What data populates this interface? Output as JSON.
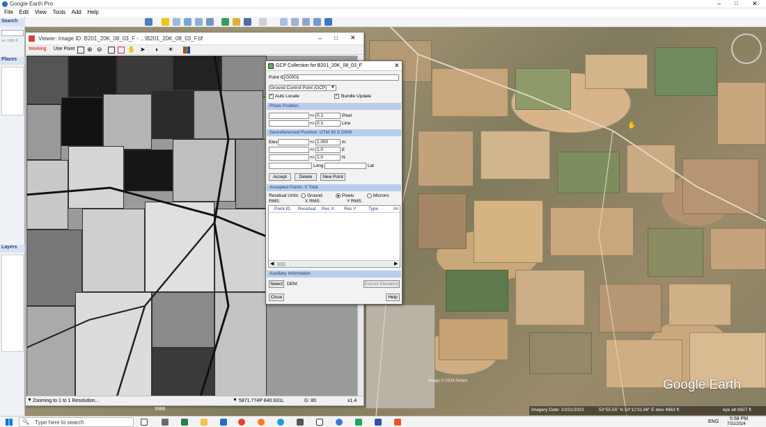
{
  "app": {
    "title": "Google Earth Pro"
  },
  "menu": [
    "File",
    "Edit",
    "View",
    "Tools",
    "Add",
    "Help"
  ],
  "left_panel": {
    "search": "Search",
    "places": "Places",
    "layers": "Layers",
    "hint": "ex: 1600 P"
  },
  "viewer": {
    "title": "Viewer: Image ID: B201_20K_08_03_F - ...\\B201_20K_08_03_F.tif",
    "mode_working": "Working",
    "mode_use_point": "Use Point",
    "status": "Zooming to 1 to 1 Resolution...",
    "coords": "5871.774P 840.931L",
    "gamma": "G: 80",
    "zoom": "x1.4",
    "bottom_left": "3986"
  },
  "gcp": {
    "title": "GCP Collection for B201_20K_08_03_F",
    "point_id_label": "Point ID",
    "point_id": "G0001",
    "point_type": "Ground Control Point (GCP)",
    "auto_locate": "Auto Locate",
    "bundle_update": "Bundle Update",
    "photo_position": "Photo Position",
    "pm": "+/-",
    "pixel_tol": "0.1",
    "line_tol": "0.1",
    "pixel": "Pixel",
    "line": "Line",
    "geo_position": "Georeferenced Position: UTM   39 S D000",
    "elev": "Elev",
    "elev_tol": "1.000",
    "m": "m",
    "e_tol": "1.0",
    "E": "E",
    "n_tol": "1.0",
    "N": "N",
    "long": "Long",
    "lat": "Lat",
    "accept": "Accept",
    "delete": "Delete",
    "new_point": "New Point",
    "accepted_points": "Accepted Points: 0 Total",
    "residual_units": "Residual Units:",
    "ground": "Ground",
    "pixels": "Pixels",
    "microns": "Microns",
    "rms": "RMS:",
    "x_rms": "X RMS:",
    "y_rms": "Y RMS:",
    "columns": [
      "Point ID",
      "Residual",
      "Res X",
      "Res Y",
      "Type",
      "Im"
    ],
    "aux_info": "Auxiliary Information",
    "select": "Select",
    "dem": "DEM:",
    "extract_elevation": "Extract Elevation",
    "close": "Close",
    "help": "Help"
  },
  "earth": {
    "brand": "Google Earth",
    "imagery_date": "Imagery Date: 10/21/2023",
    "coords": "53°55.55\" N   50°12'31.66\" E   elev 4963 ft",
    "eye_alt": "eye alt 6927 ft",
    "small_label": "Image © 2024 Airbus"
  },
  "taskbar": {
    "search": "Type here to search",
    "lang": "ENG",
    "time": "5:58 PM",
    "date": "7/31/2024"
  }
}
